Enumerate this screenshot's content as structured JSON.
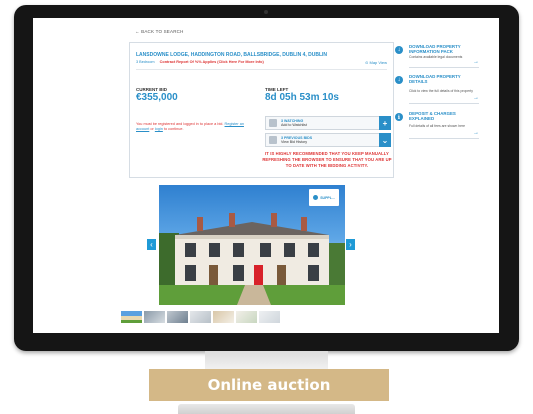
{
  "screen": {
    "back_link": "← BACK TO SEARCH",
    "address": "LANSDOWNE LODGE, HADDINGTON ROAD, BALLSBRIDGE, DUBLIN 4, DUBLIN",
    "beds": "3 Bedroom",
    "report_link": "Contract Report Of %% Applies (Click Here For More Info)",
    "map_view": "Map View",
    "current_bid_label": "CURRENT BID",
    "current_bid_value": "€355,000",
    "time_left_label": "TIME LEFT",
    "time_left_value": "8d 05h 53m 10s",
    "registration_note_pre": "You must be registered and logged in to place a bid.",
    "register_link": "Register an account",
    "or_text": "or",
    "login_link": "login",
    "to_continue": "to continue.",
    "watching_title": "3 WATCHING",
    "watching_action": "Add to Watchlist",
    "prev_bids_title": "3 PREVIOUS BIDS",
    "prev_bids_action": "View Bid History",
    "warning": "IT IS HIGHLY RECOMMENDED THAT YOU KEEP MANUALLY REFRESHING THE BROWSER TO ENSURE THAT YOU ARE UP TO DATE WITH THE BIDDING ACTIVITY."
  },
  "docs": [
    {
      "title": "DOWNLOAD PROPERTY INFORMATION PACK",
      "sub": "Contains available legal documents"
    },
    {
      "title": "DOWNLOAD PROPERTY DETAILS",
      "sub": "Click to view the full details of this property"
    },
    {
      "title": "DEPOSIT & CHARGES EXPLAINED",
      "sub": "Full details of all fees are shown here"
    }
  ],
  "photo_badge": "SUPPL...",
  "caption": "Online auction",
  "colors": {
    "accent": "#2a8fc8",
    "warning": "#dd3333",
    "caption_bg": "#d4b887",
    "frame": "#151515"
  }
}
